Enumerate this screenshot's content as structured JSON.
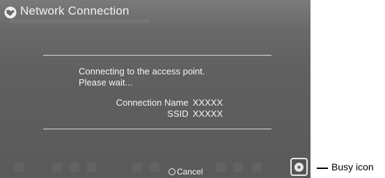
{
  "window": {
    "title": "Network Connection",
    "title_icon": "network-globe-icon"
  },
  "dialog": {
    "message_line1": "Connecting to the access point.",
    "message_line2": "Please wait...",
    "connection_name_label": "Connection Name",
    "connection_name_value": "XXXXX",
    "ssid_label": "SSID",
    "ssid_value": "XXXXX"
  },
  "footer": {
    "cancel_label": "Cancel",
    "cancel_icon": "circle-button-icon",
    "busy_icon": "busy-spinner-icon"
  },
  "annotation": {
    "busy_icon_label": "Busy icon"
  },
  "colors": {
    "screen_bg": "#606060",
    "text": "#f4f4f4",
    "divider": "#d8d8d8"
  }
}
